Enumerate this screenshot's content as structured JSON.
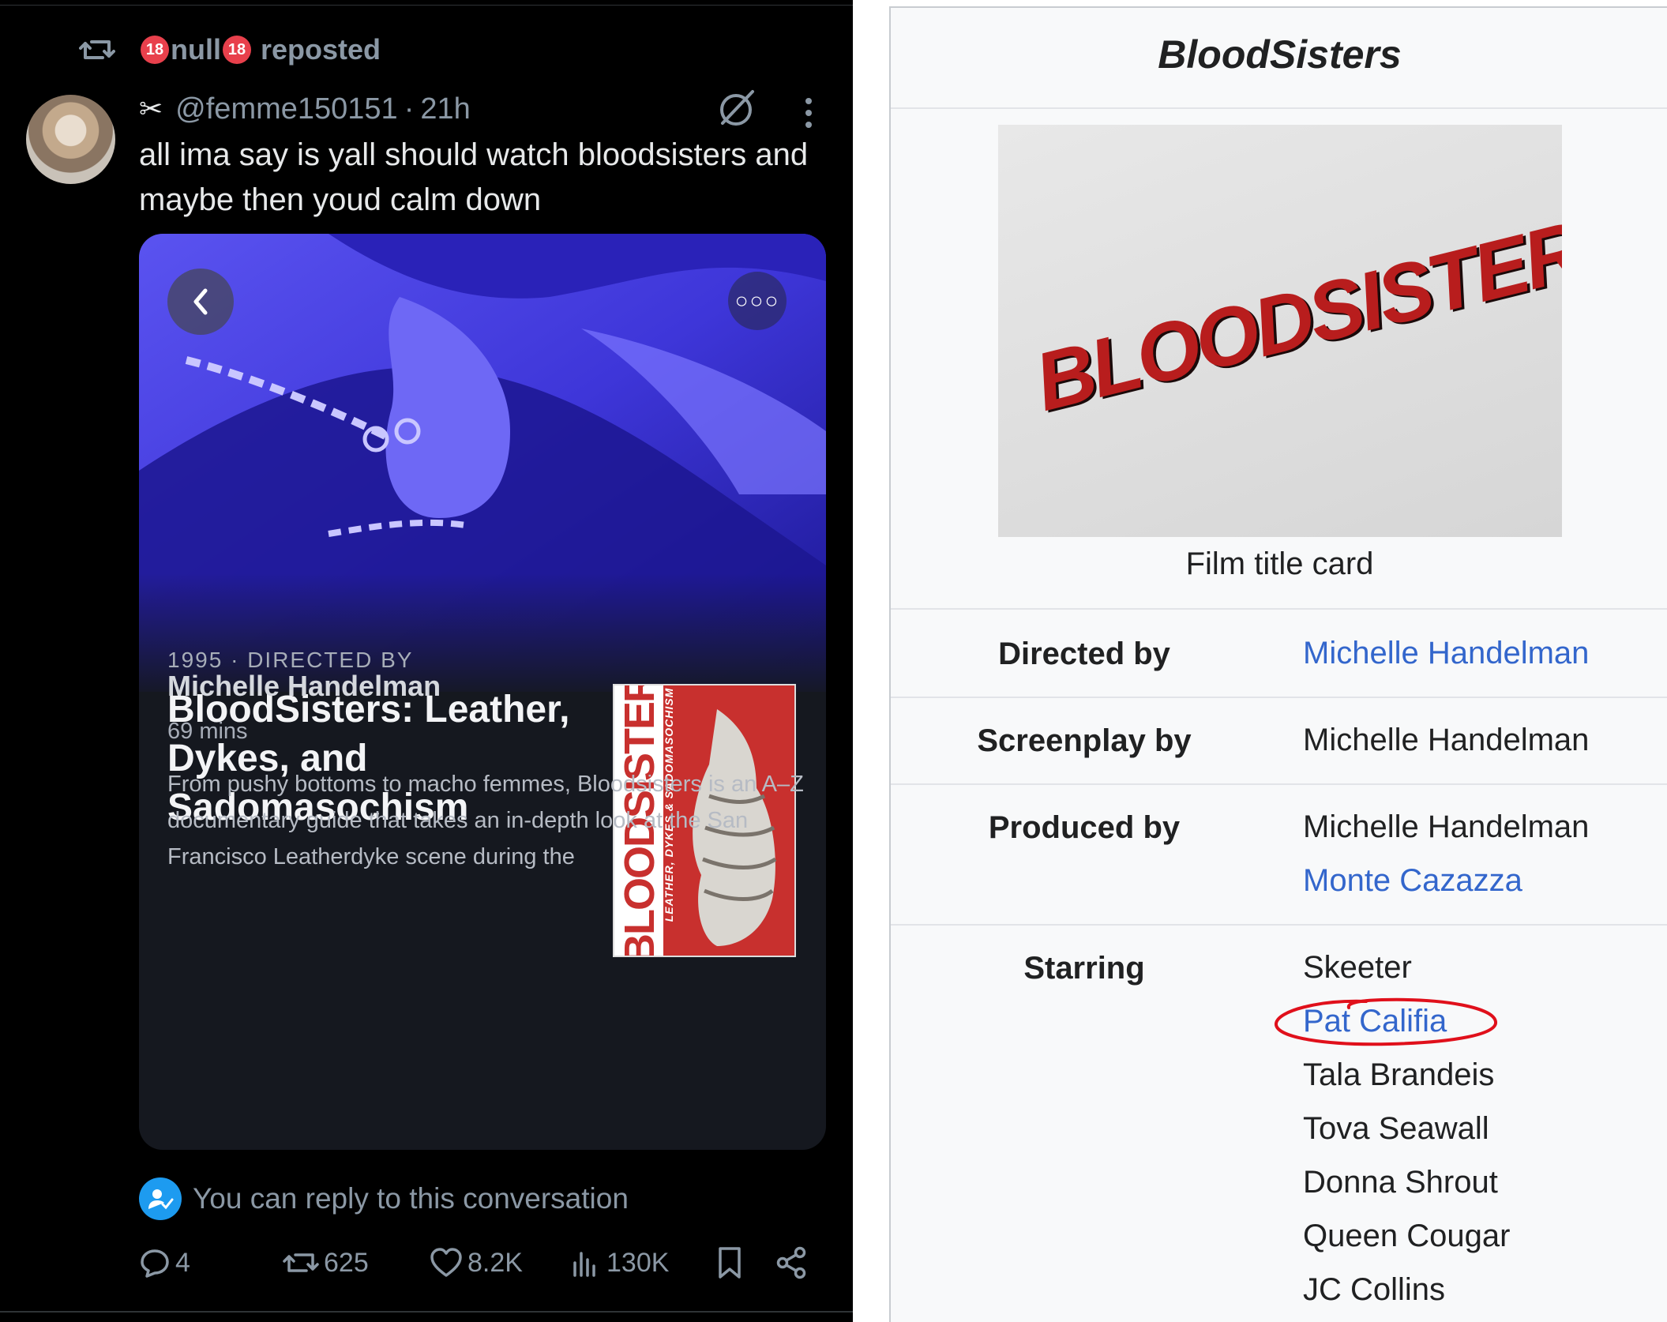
{
  "post": {
    "repost_name": "null",
    "repost_suffix": "reposted",
    "handle": "@femme150151",
    "time": "21h",
    "text": "all ima say is yall should watch bloodsisters and maybe then youd calm down",
    "card": {
      "title": "BloodSisters: Leather, Dykes, and Sadomasochism",
      "year": "1995",
      "directed_by_label": "DIRECTED BY",
      "director": "Michelle Handelman",
      "runtime": "69 mins",
      "synopsis": "From pushy bottoms to macho femmes, Bloodsisters is an A–Z documentary guide that takes an in-depth look at the San Francisco Leatherdyke scene during the",
      "poster_title": "BLOODSISTERS",
      "poster_subtitle": "LEATHER, DYKES & SADOMASOCHISM"
    },
    "reply_prompt": "You can reply to this conversation",
    "actions": {
      "replies": "4",
      "reposts": "625",
      "likes": "8.2K",
      "views": "130K"
    },
    "colors": {
      "background": "#000000",
      "accent": "#1d9bf0",
      "muted": "#8b98a5"
    }
  },
  "infobox": {
    "title": "BloodSisters",
    "title_card_text": "BLOODSISTERS",
    "caption": "Film title card",
    "rows": {
      "directed_by": {
        "label": "Directed by",
        "value": "Michelle Handelman"
      },
      "screenplay_by": {
        "label": "Screenplay by",
        "value": "Michelle Handelman"
      },
      "produced_by": {
        "label": "Produced by",
        "values": [
          "Michelle Handelman",
          "Monte Cazazza"
        ]
      },
      "starring": {
        "label": "Starring",
        "values": [
          "Skeeter",
          "Pat Califia",
          "Tala Brandeis",
          "Tova Seawall",
          "Donna Shrout",
          "Queen Cougar",
          "JC Collins"
        ]
      }
    },
    "colors": {
      "link": "#3366cc",
      "annotation": "#e0101b"
    }
  }
}
